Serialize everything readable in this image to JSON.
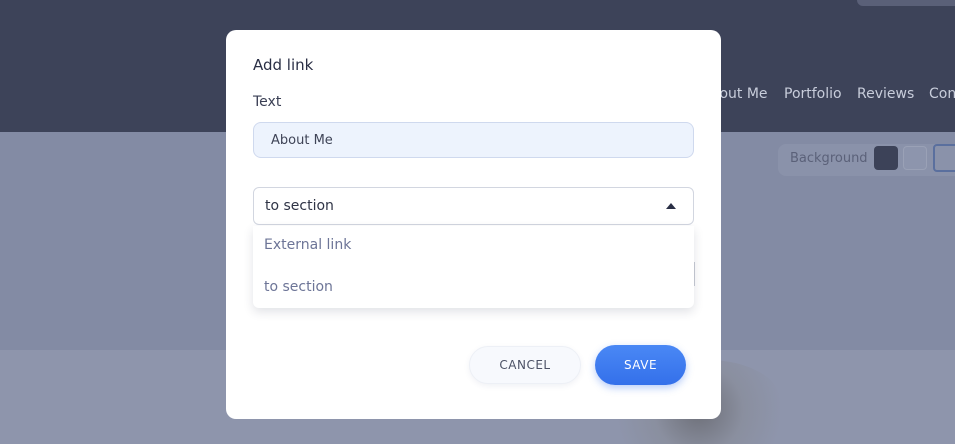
{
  "background": {
    "nav": [
      "About Me",
      "Portfolio",
      "Reviews",
      "Contacts"
    ],
    "background_label": "Background"
  },
  "modal": {
    "title": "Add link",
    "text_label": "Text",
    "text_value": "About Me",
    "link_type": {
      "selected": "to section",
      "options": [
        "External link",
        "to section"
      ]
    },
    "cancel_label": "CANCEL",
    "save_label": "SAVE"
  },
  "colors": {
    "accent": "#3f7cf0",
    "overlay_header": "#3d4359",
    "overlay_body": "#838ba4"
  }
}
